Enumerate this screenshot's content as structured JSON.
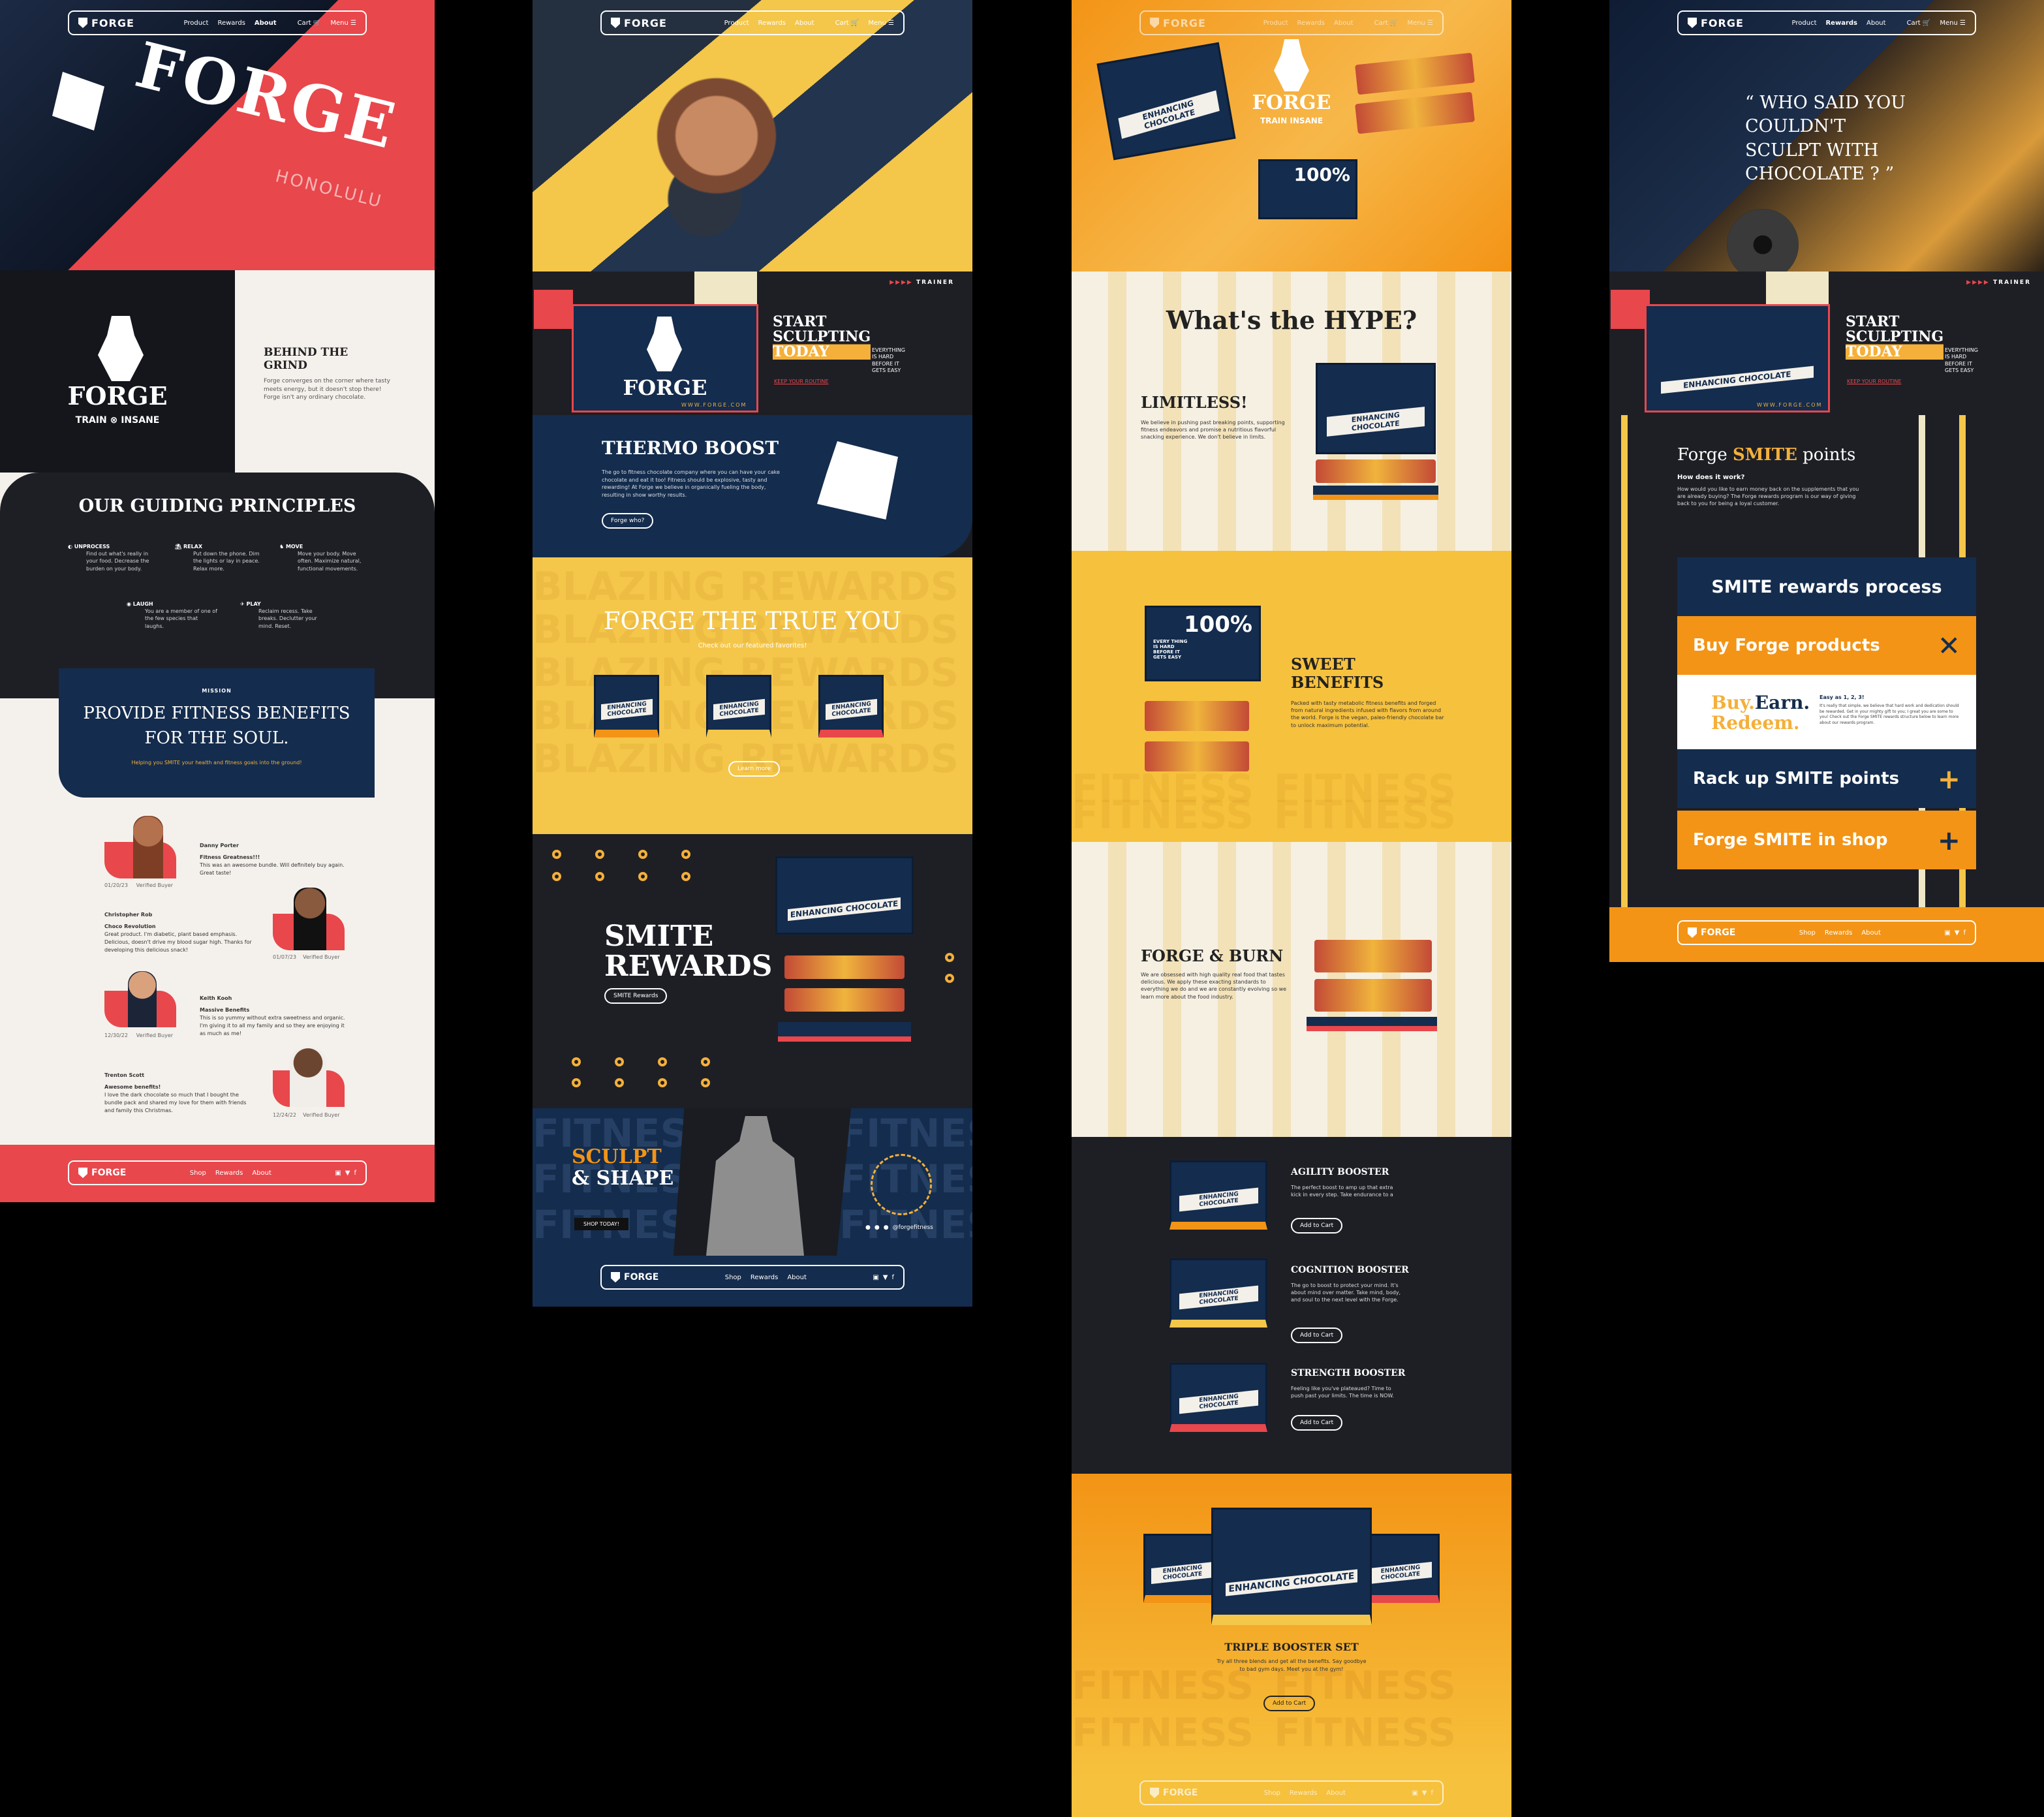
{
  "nav": {
    "brand": "FORGE",
    "product": "Product",
    "rewards": "Rewards",
    "about": "About",
    "cart": "Cart",
    "menu": "Menu"
  },
  "footer": {
    "brand": "FORGE",
    "shop": "Shop",
    "rewards": "Rewards",
    "about": "About"
  },
  "about": {
    "hero_title": "FORGE",
    "hero_sub": "HONOLULU",
    "logo_word": "FORGE",
    "logo_train": "TRAIN",
    "logo_insane": "INSANE",
    "grind_title": "BEHIND THE GRIND",
    "grind_body": "Forge converges on the corner where tasty meets energy, but it doesn't stop there! Forge isn't any ordinary chocolate.",
    "principles_title": "OUR GUIDING PRINCIPLES",
    "principles": [
      {
        "title": "UNPROCESS",
        "body": "Find out what's really in your food. Decrease the burden on your body."
      },
      {
        "title": "RELAX",
        "body": "Put down the phone. Dim the lights or lay in peace. Relax more."
      },
      {
        "title": "MOVE",
        "body": "Move your body. Move often. Maximize natural, functional movements."
      },
      {
        "title": "LAUGH",
        "body": "You are a member of one of the few species that laughs."
      },
      {
        "title": "PLAY",
        "body": "Reclaim recess. Take breaks. Declutter your mind. Reset."
      }
    ],
    "mission_label": "MISSION",
    "mission_title": "PROVIDE FITNESS BENEFITS FOR THE SOUL.",
    "mission_sub": "Helping you SMITE your health and fitness goals into the ground!",
    "reviews": [
      {
        "name": "Danny Porter",
        "title": "Fitness Greatness!!!",
        "body": "This was an awesome bundle. Will definitely buy again. Great taste!",
        "date": "01/20/23",
        "verified": "Verified Buyer"
      },
      {
        "name": "Christopher Rob",
        "title": "Choco Revolution",
        "body": "Great product. I'm diabetic, plant based emphasis. Delicious, doesn't drive my blood sugar high. Thanks for developing this delicious snack!",
        "date": "01/07/23",
        "verified": "Verified Buyer"
      },
      {
        "name": "Keith Kooh",
        "title": "Massive Benefits",
        "body": "This is so yummy without extra sweetness and organic. I'm giving it to all my family and so they are enjoying it as much as me!",
        "date": "12/30/22",
        "verified": "Verified Buyer"
      },
      {
        "name": "Trenton Scott",
        "title": "Awesome benefits!",
        "body": "I love the dark chocolate so much that I bought the bundle pack and shared my love for them with friends and family this Christmas.",
        "date": "12/24/22",
        "verified": "Verified Buyer"
      }
    ]
  },
  "home": {
    "trainer_label": "TRAINER",
    "start_title": "START SCULPTING TODAY",
    "start_side": "EVERYTHING IS HARD BEFORE IT GETS EASY",
    "start_link": "KEEP YOUR ROUTINE",
    "card_logo": "FORGE",
    "card_url": "WWW.FORGE.COM",
    "thermo_title": "THERMO BOOST",
    "thermo_body": "The go to fitness chocolate company where you can have your cake chocolate and eat it too! Fitness should be explosive, tasty and rewarding! At Forge we believe in organically fueling the body, resulting in show worthy results.",
    "thermo_btn": "Forge who?",
    "true_title": "FORGE THE TRUE YOU",
    "true_sub": "Check out our featured favorites!",
    "true_btn": "Learn more",
    "wm_text": "BLAZING REWARDS",
    "smite_title": "SMITE REWARDS",
    "smite_btn": "SMITE Rewards",
    "sculpt_title1": "SCULPT",
    "sculpt_title2": "& SHAPE",
    "sculpt_btn": "SHOP TODAY!",
    "social_handle": "@forgefitness",
    "wm_fit": "FITNESS",
    "box_label": "ENHANCING CHOCOLATE"
  },
  "products": {
    "hero_brand": "FORGE",
    "hero_tag": "TRAIN INSANE",
    "badge_percent": "100%",
    "badge_text": "EVERY THING IS HARD BEFORE IT GETS EASY",
    "hype_title": "What's the HYPE?",
    "limitless_title": "LIMITLESS!",
    "limitless_body": "We believe in pushing past breaking points, supporting fitness endeavors and promise a nutritious flavorful snacking experience. We don't believe in limits.",
    "sweet_title": "SWEET BENEFITS",
    "sweet_body": "Packed with tasty metabolic fitness benefits and forged from natural ingredients infused with flavors from around the world. Forge is the vegan, paleo-friendly chocolate bar to unlock maximum potential.",
    "burn_title": "FORGE & BURN",
    "burn_body": "We are obsessed with high quality real food that tastes delicious. We apply these exacting standards to everything we do and we are constantly evolving so we learn more about the food industry.",
    "wm_fitness": "FITNESS",
    "list": [
      {
        "title": "AGILITY BOOSTER",
        "body": "The perfect boost to amp up that extra kick in every step. Take endurance to a",
        "btn": "Add to Cart"
      },
      {
        "title": "COGNITION BOOSTER",
        "body": "The go to boost to protect your mind. It's about mind over matter. Take mind, body, and soul to the next level with the Forge.",
        "btn": "Add to Cart"
      },
      {
        "title": "STRENGTH BOOSTER",
        "body": "Feeling like you've plateaued? Time to push past your limits. The time is NOW.",
        "btn": "Add to Cart"
      }
    ],
    "triple_title": "TRIPLE BOOSTER SET",
    "triple_body": "Try all three blends and get all the benefits. Say goodbye to bad gym days. Meet you at the gym!",
    "triple_btn": "Add to Cart",
    "box_label": "ENHANCING CHOCOLATE"
  },
  "rewards": {
    "quote": "“ WHO SAID YOU COULDN'T SCULPT WITH CHOCOLATE ? ”",
    "trainer_label": "TRAINER",
    "start_title": "START SCULPTING TODAY",
    "start_side": "EVERYTHING IS HARD BEFORE IT GETS EASY",
    "start_link": "KEEP YOUR ROUTINE",
    "card_url": "WWW.FORGE.COM",
    "smite_title_a": "Forge ",
    "smite_title_b": "SMITE",
    "smite_title_c": " points",
    "how": "How does it work?",
    "how_body": "How would you like to earn money back on the supplements that you are already buying? The Forge rewards program is our way of giving back to you for being a loyal customer.",
    "process_title": "SMITE rewards process",
    "step1": "Buy Forge products",
    "step1_sign": "✕",
    "buy": "Buy.",
    "earn": "Earn.",
    "redeem": "Redeem.",
    "easy": "Easy as 1, 2, 3!",
    "easy_body": "It's really that simple, we believe that hard work and dedication should be rewarded. Get in your mighty gift to you; I great you are some to you! Check out the Forge SMITE rewards structure below to learn more about our rewards program.",
    "step2": "Rack up SMITE points",
    "step3": "Forge SMITE in shop",
    "plus": "+",
    "box_label": "ENHANCING CHOCOLATE"
  },
  "colors": {
    "red": "#e8474c",
    "navy": "#142c4d",
    "yellow": "#f4b03a",
    "orange": "#f39416",
    "dark": "#1b1c22",
    "cream": "#f4f1ec"
  }
}
